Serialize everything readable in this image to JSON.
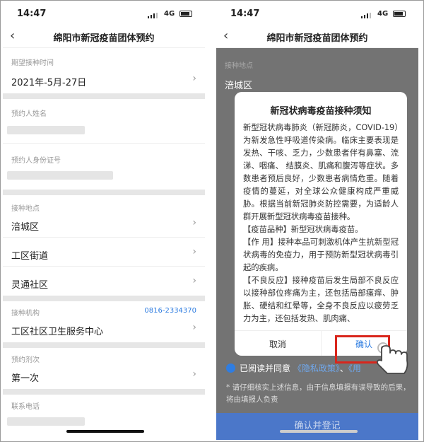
{
  "status": {
    "time": "14:47",
    "network": "4G"
  },
  "nav": {
    "title": "绵阳市新冠疫苗团体预约"
  },
  "form": {
    "date_label": "期望接种时间",
    "date_value": "2021年-5月-27日",
    "name_label": "预约人姓名",
    "id_label": "预约人身份证号",
    "site_label": "接种地点",
    "district": "涪城区",
    "street": "工区街道",
    "community": "灵通社区",
    "org_label": "接种机构",
    "org_phone": "0816-2334370",
    "org_value": "工区社区卫生服务中心",
    "dose_label": "预约剂次",
    "dose_value": "第一次",
    "contact_label": "联系电话"
  },
  "right_bg": {
    "site_label": "接种地点",
    "district": "涪城区",
    "agree_prefix": "已阅读并同意",
    "privacy_link": "《隐私政策》",
    "user_link": "《用",
    "notice": "* 请仔细核实上述信息，由于信息填报有误导致的后果，将由填报人负责",
    "submit": "确认并登记"
  },
  "modal": {
    "title": "新冠状病毒疫苗接种须知",
    "para1": "新型冠状病毒肺炎（新冠肺炎，COVID-19）为新发急性呼吸道传染病。临床主要表现是发热、干咳、乏力，少数患者伴有鼻塞、流涕、咽痛、 结膜炎、肌痛和腹泻等症状。多数患者预后良好，少数患者病情危重。随着疫情的蔓延，对全球公众健康构成严重威胁。根据当前新冠肺炎防控需要，为适龄人群开展新型冠状病毒疫苗接种。",
    "para2": "【疫苗品种】新型冠状病毒疫苗。",
    "para3": "【作 用】接种本品可刺激机体产生抗新型冠状病毒的免疫力，用于预防新型冠状病毒引起的疾病。",
    "para4": "【不良反应】接种疫苗后发生局部不良反应以接种部位疼痛为主，还包括局部瘙痒、肿胀、硬结和红晕等，全身不良反应以疲劳乏力为主，还包括发热、肌肉痛、",
    "cancel": "取消",
    "ok": "确认"
  },
  "colors": {
    "accent": "#2f7de1",
    "highlight": "#d9261c"
  }
}
